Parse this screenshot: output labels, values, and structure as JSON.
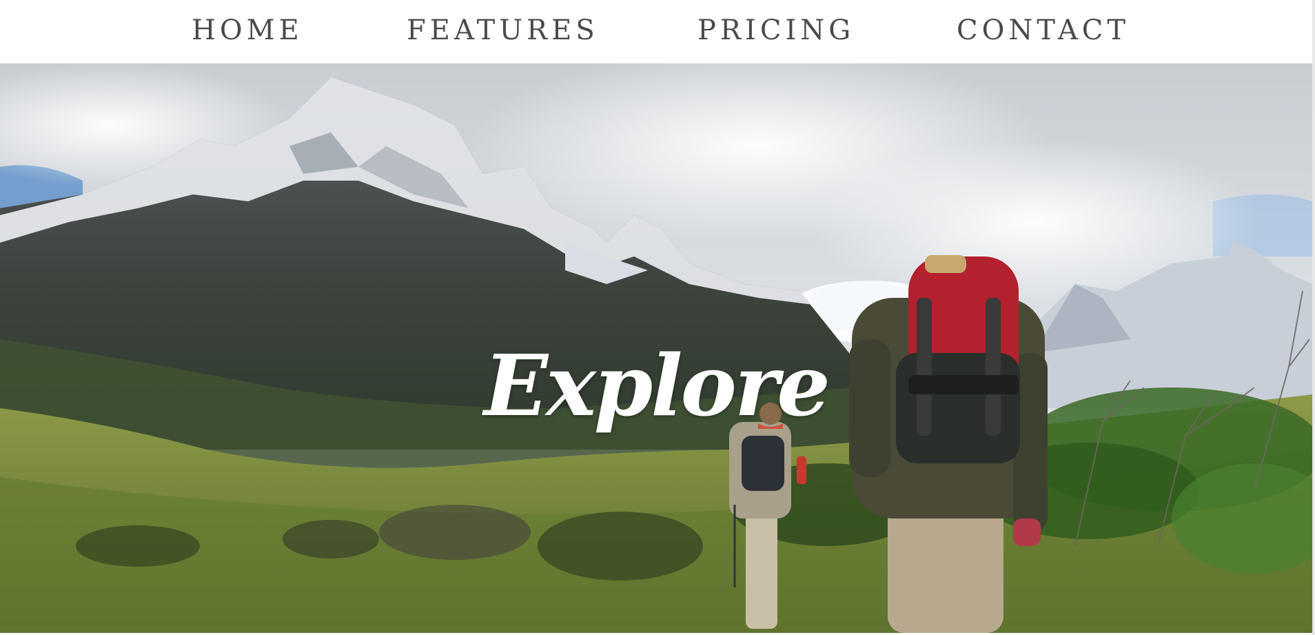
{
  "nav": {
    "items": [
      {
        "label": "HOME"
      },
      {
        "label": "FEATURES"
      },
      {
        "label": "PRICING"
      },
      {
        "label": "CONTACT"
      }
    ]
  },
  "hero": {
    "title": "Explore",
    "image": "mountain-hikers-photo"
  },
  "colors": {
    "nav_text": "#4a4a4a",
    "nav_background": "#ffffff",
    "hero_title": "#ffffff",
    "pack_red": "#b3202e"
  }
}
